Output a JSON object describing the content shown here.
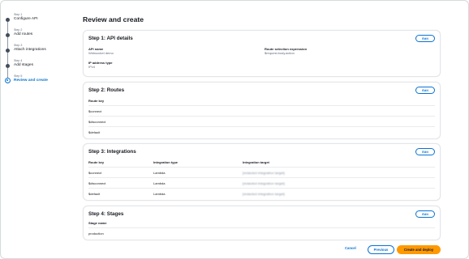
{
  "wizard": {
    "steps": [
      {
        "number": "Step 1",
        "label": "Configure API"
      },
      {
        "number": "Step 2",
        "label": "Add routes"
      },
      {
        "number": "Step 3",
        "label": "Attach integrations"
      },
      {
        "number": "Step 4",
        "label": "Add stages"
      },
      {
        "number": "Step 5",
        "label": "Review and create"
      }
    ],
    "current_step": 5
  },
  "page": {
    "title": "Review and create"
  },
  "edit_label": "Edit",
  "api_details": {
    "title": "Step 1: API details",
    "api_name_label": "API name",
    "api_name_value": "Websocket demo",
    "route_sel_label": "Route selection expression",
    "route_sel_value": "$request.body.action",
    "ip_label": "IP address type",
    "ip_value": "IPv4"
  },
  "routes": {
    "title": "Step 2: Routes",
    "header": "Route key",
    "rows": [
      "$connect",
      "$disconnect",
      "$default"
    ]
  },
  "integrations": {
    "title": "Step 3: Integrations",
    "headers": [
      "Route key",
      "Integration type",
      "Integration target"
    ],
    "rows": [
      [
        "$connect",
        "Lambda",
        "[redacted integration target]"
      ],
      [
        "$disconnect",
        "Lambda",
        "[redacted integration target]"
      ],
      [
        "$default",
        "Lambda",
        "[redacted integration target]"
      ]
    ]
  },
  "stages": {
    "title": "Step 4: Stages",
    "header": "Stage name",
    "rows": [
      "production"
    ]
  },
  "footer": {
    "cancel": "Cancel",
    "previous": "Previous",
    "create": "Create and deploy"
  },
  "colors": {
    "accent": "#0972d3",
    "primary_button": "#ff9900",
    "text": "#16191f",
    "muted_text": "#5f6b7a"
  }
}
